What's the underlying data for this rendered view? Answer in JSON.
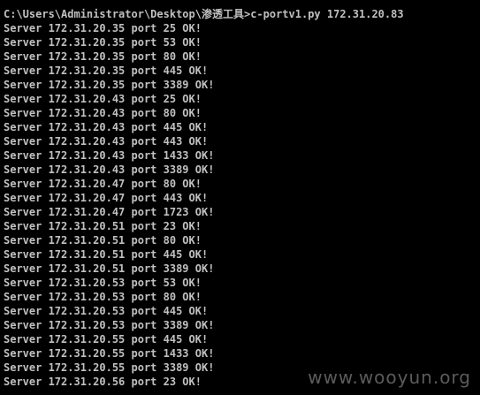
{
  "console": {
    "command_line": "C:\\Users\\Administrator\\Desktop\\渗透工具>c-portv1.py 172.31.20.83",
    "output_lines": [
      "Server 172.31.20.35 port 25 OK!",
      "Server 172.31.20.35 port 53 OK!",
      "Server 172.31.20.35 port 80 OK!",
      "Server 172.31.20.35 port 445 OK!",
      "Server 172.31.20.35 port 3389 OK!",
      "Server 172.31.20.43 port 25 OK!",
      "Server 172.31.20.43 port 80 OK!",
      "Server 172.31.20.43 port 445 OK!",
      "Server 172.31.20.43 port 443 OK!",
      "Server 172.31.20.43 port 1433 OK!",
      "Server 172.31.20.43 port 3389 OK!",
      "Server 172.31.20.47 port 80 OK!",
      "Server 172.31.20.47 port 443 OK!",
      "Server 172.31.20.47 port 1723 OK!",
      "Server 172.31.20.51 port 23 OK!",
      "Server 172.31.20.51 port 80 OK!",
      "Server 172.31.20.51 port 445 OK!",
      "Server 172.31.20.51 port 3389 OK!",
      "Server 172.31.20.53 port 53 OK!",
      "Server 172.31.20.53 port 80 OK!",
      "Server 172.31.20.53 port 445 OK!",
      "Server 172.31.20.53 port 3389 OK!",
      "Server 172.31.20.55 port 445 OK!",
      "Server 172.31.20.55 port 1433 OK!",
      "Server 172.31.20.55 port 3389 OK!",
      "Server 172.31.20.56 port 23 OK!"
    ]
  },
  "watermark": {
    "text": "www.wooyun.org"
  },
  "colors": {
    "background": "#000000",
    "text": "#c0c0c0",
    "watermark": "#7a7a7a"
  }
}
